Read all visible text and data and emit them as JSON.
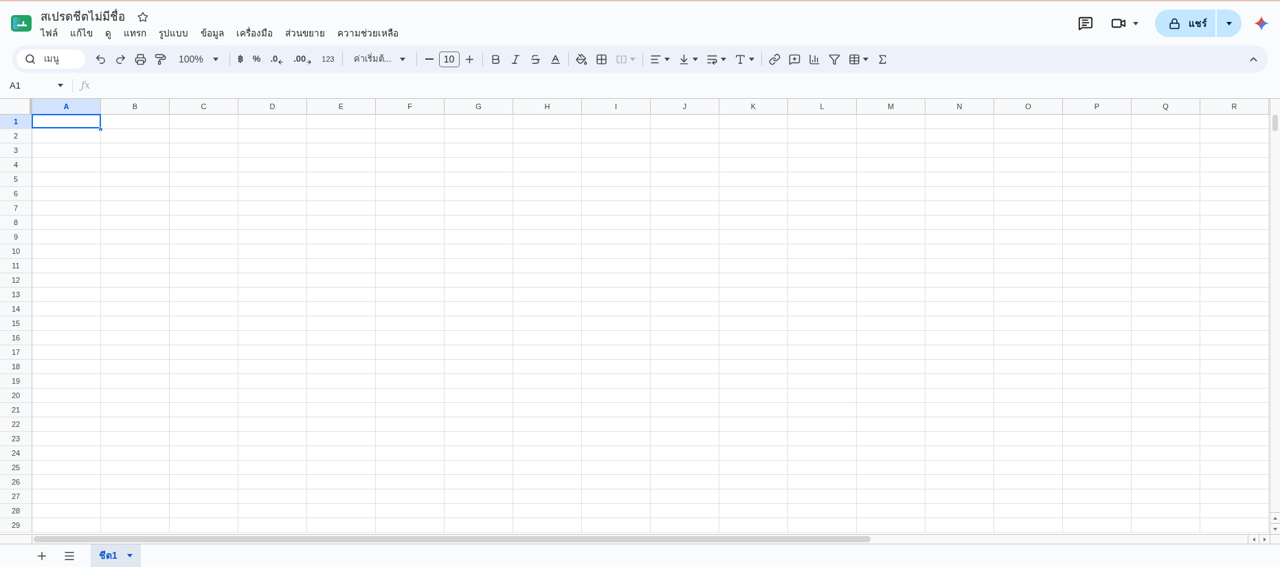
{
  "document": {
    "title": "สเปรดชีตไม่มีชื่อ",
    "starred": false
  },
  "menu": [
    "ไฟล์",
    "แก้ไข",
    "ดู",
    "แทรก",
    "รูปแบบ",
    "ข้อมูล",
    "เครื่องมือ",
    "ส่วนขยาย",
    "ความช่วยเหลือ"
  ],
  "share": {
    "label": "แชร์"
  },
  "toolbar": {
    "search_placeholder": "เมนู",
    "zoom": "100%",
    "currency": "฿",
    "percent": "%",
    "decrease_decimals": ".0",
    "increase_decimals": ".00",
    "more_formats": "123",
    "font": "ค่าเริ่มต้...",
    "font_size": "10",
    "merge_disabled": true
  },
  "formula_bar": {
    "cell_ref": "A1",
    "function_label": "ƒx"
  },
  "grid": {
    "columns": [
      {
        "label": "A",
        "selected": true
      },
      {
        "label": "B",
        "selected": false
      },
      {
        "label": "C",
        "selected": false
      },
      {
        "label": "D",
        "selected": false
      },
      {
        "label": "E",
        "selected": false
      },
      {
        "label": "F",
        "selected": false
      },
      {
        "label": "G",
        "selected": false
      },
      {
        "label": "H",
        "selected": false
      },
      {
        "label": "I",
        "selected": false
      },
      {
        "label": "J",
        "selected": false
      },
      {
        "label": "K",
        "selected": false
      },
      {
        "label": "L",
        "selected": false
      },
      {
        "label": "M",
        "selected": false
      },
      {
        "label": "N",
        "selected": false
      },
      {
        "label": "O",
        "selected": false
      },
      {
        "label": "P",
        "selected": false
      },
      {
        "label": "Q",
        "selected": false
      },
      {
        "label": "R",
        "selected": false
      }
    ],
    "rows": [
      {
        "label": "1",
        "selected": true
      },
      {
        "label": "2",
        "selected": false
      },
      {
        "label": "3",
        "selected": false
      },
      {
        "label": "4",
        "selected": false
      },
      {
        "label": "5",
        "selected": false
      },
      {
        "label": "6",
        "selected": false
      },
      {
        "label": "7",
        "selected": false
      },
      {
        "label": "8",
        "selected": false
      },
      {
        "label": "9",
        "selected": false
      },
      {
        "label": "10",
        "selected": false
      },
      {
        "label": "11",
        "selected": false
      },
      {
        "label": "12",
        "selected": false
      },
      {
        "label": "13",
        "selected": false
      },
      {
        "label": "14",
        "selected": false
      },
      {
        "label": "15",
        "selected": false
      },
      {
        "label": "16",
        "selected": false
      },
      {
        "label": "17",
        "selected": false
      },
      {
        "label": "18",
        "selected": false
      },
      {
        "label": "19",
        "selected": false
      },
      {
        "label": "20",
        "selected": false
      },
      {
        "label": "21",
        "selected": false
      },
      {
        "label": "22",
        "selected": false
      },
      {
        "label": "23",
        "selected": false
      },
      {
        "label": "24",
        "selected": false
      },
      {
        "label": "25",
        "selected": false
      },
      {
        "label": "26",
        "selected": false
      },
      {
        "label": "27",
        "selected": false
      },
      {
        "label": "28",
        "selected": false
      },
      {
        "label": "29",
        "selected": false
      }
    ]
  },
  "sheet_tabs": [
    {
      "label": "ชีต1",
      "selected": true
    }
  ]
}
